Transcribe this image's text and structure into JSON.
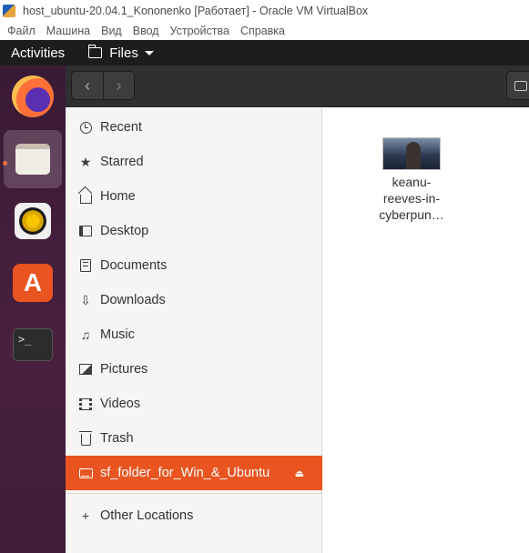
{
  "window": {
    "title": "host_ubuntu-20.04.1_Kononenko [Работает] - Oracle VM VirtualBox",
    "menu": [
      "Файл",
      "Машина",
      "Вид",
      "Ввод",
      "Устройства",
      "Справка"
    ]
  },
  "topbar": {
    "activities": "Activities",
    "app_menu": "Files"
  },
  "dock": {
    "apps": [
      "firefox-icon",
      "files-icon",
      "rhythmbox-icon",
      "ubuntu-software-icon",
      "terminal-icon"
    ],
    "terminal_glyph": ">_",
    "store_glyph": "A"
  },
  "headerbar": {
    "back_glyph": "‹",
    "forward_glyph": "›"
  },
  "sidebar": {
    "items": [
      {
        "label": "Recent",
        "icon": "clock-icon"
      },
      {
        "label": "Starred",
        "icon": "star-icon"
      },
      {
        "label": "Home",
        "icon": "home-icon"
      },
      {
        "label": "Desktop",
        "icon": "desktop-icon"
      },
      {
        "label": "Documents",
        "icon": "document-icon"
      },
      {
        "label": "Downloads",
        "icon": "download-icon"
      },
      {
        "label": "Music",
        "icon": "music-icon"
      },
      {
        "label": "Pictures",
        "icon": "pictures-icon"
      },
      {
        "label": "Videos",
        "icon": "video-icon"
      },
      {
        "label": "Trash",
        "icon": "trash-icon"
      },
      {
        "label": "sf_folder_for_Win_&_Ubuntu",
        "icon": "drive-icon",
        "selected": true
      },
      {
        "label": "Other Locations",
        "icon": "plus-icon"
      }
    ],
    "eject_glyph": "⏏",
    "accent": "#e95420"
  },
  "content": {
    "files": [
      {
        "name": "keanu-reeves-in-cyberpun…",
        "lines": [
          "keanu-",
          "reeves-in-",
          "cyberpun…"
        ],
        "icon": "image-thumbnail"
      }
    ]
  }
}
